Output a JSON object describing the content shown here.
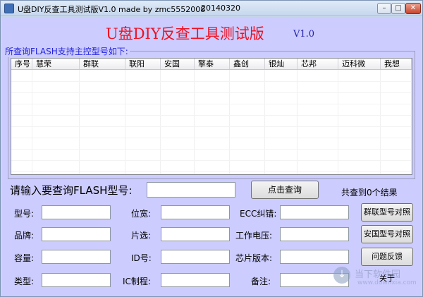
{
  "window": {
    "title": "U盘DIY反查工具测试版V1.0   made by zmc5552008",
    "date": "20140320",
    "controls": {
      "minimize": "–",
      "maximize": "□",
      "close": "✕"
    }
  },
  "header": {
    "title": "U盘DIY反查工具测试版",
    "version": "V1.0"
  },
  "list_group": {
    "label": "所查询FLASH支持主控型号如下:",
    "columns": [
      "序号",
      "慧荣",
      "群联",
      "联阳",
      "安国",
      "擎泰",
      "鑫创",
      "银灿",
      "芯邦",
      "迈科微",
      "我想"
    ],
    "rows": []
  },
  "search": {
    "prompt": "请输入要查询FLASH型号:",
    "value": "",
    "button": "点击查询",
    "result": "共查到0个结果"
  },
  "fields": {
    "model": "型号:",
    "width": "位宽:",
    "ecc": "ECC纠错:",
    "brand": "品牌:",
    "chip_select": "片选:",
    "voltage": "工作电压:",
    "capacity": "容量:",
    "id": "ID号:",
    "chip_version": "芯片版本:",
    "type": "类型:",
    "process": "IC制程:",
    "note": "备注:"
  },
  "side_buttons": {
    "phison": "群联型号对照",
    "alcor": "安国型号对照",
    "feedback": "问题反馈",
    "about": "关于"
  },
  "watermark": {
    "text": "当下软件园",
    "url": "www.downxia.com"
  }
}
